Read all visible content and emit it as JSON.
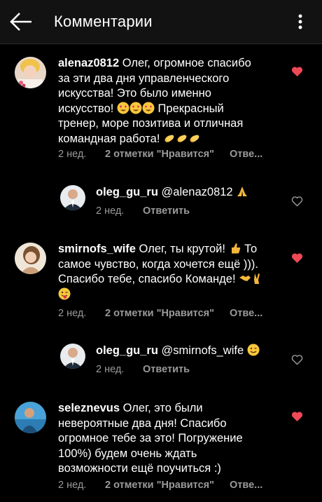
{
  "header": {
    "title": "Комментарии"
  },
  "comments": [
    {
      "username": "alenaz0812",
      "text_lines": [
        "Олег, огромное спасибо",
        "за эти два дня управленческого",
        "искусства! Это было именно",
        "искусство!",
        "Прекрасный",
        "тренер, море позитива  и отличная",
        "командная работа!"
      ],
      "time": "2 нед.",
      "likes": "2 отметки \"Нравится\"",
      "reply": "Отве...",
      "liked": true,
      "emojis": [
        "heart-eyes",
        "heart-eyes",
        "heart-eyes",
        "clapping",
        "clapping",
        "clapping"
      ]
    },
    {
      "username": "oleg_gu_ru",
      "mention": "@alenaz0812",
      "time": "2 нед.",
      "reply": "Ответить",
      "liked": false,
      "emojis": [
        "folded-hands"
      ]
    },
    {
      "username": "smirnofs_wife",
      "text_lines": [
        "Олег, ты крутой!",
        "То",
        "самое чувство, когда хочется ещё ))).",
        "Спасибо тебе, спасибо Команде!"
      ],
      "time": "2 нед.",
      "likes": "2 отметки \"Нравится\"",
      "reply": "Отве...",
      "liked": true,
      "emojis": [
        "thumbs-up",
        "handshake",
        "victory-hand",
        "tongue-wink"
      ]
    },
    {
      "username": "oleg_gu_ru",
      "mention": "@smirnofs_wife",
      "time": "2 нед.",
      "reply": "Ответить",
      "liked": false,
      "emojis": [
        "wink"
      ]
    },
    {
      "username": "seleznevus",
      "text_lines": [
        "Олег, это были",
        "невероятные два дня! Спасибо",
        "огромное тебе за это! Погружение",
        "100%) будем очень ждать",
        "возможности ещё поучиться :)"
      ],
      "time": "2 нед.",
      "likes": "2 отметки \"Нравится\"",
      "reply": "Отве...",
      "liked": true
    }
  ],
  "colors": {
    "background": "#000000",
    "header_bg": "#121212",
    "text": "#ffffff",
    "meta": "#9a9a9a",
    "like_red": "#ed4956"
  }
}
